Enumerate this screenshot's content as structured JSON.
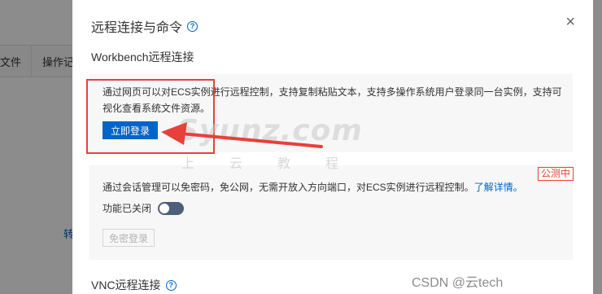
{
  "background": {
    "columns": [
      "文件",
      "操作记"
    ],
    "link_text": "转"
  },
  "dialog": {
    "title": "远程连接与命令",
    "close_glyph": "×",
    "workbench": {
      "label": "Workbench远程连接",
      "description": "通过网页可以对ECS实例进行远程控制，支持复制粘贴文本，支持多操作系统用户登录同一台实例，支持可视化查看系统文件资源。",
      "login_button": "立即登录"
    },
    "session": {
      "badge": "公测中",
      "description": "通过会话管理可以免密码，免公网，无需开放入方向端口，对ECS实例进行远程控制。",
      "link_text": "了解详情。",
      "toggle_label": "功能已关闭",
      "toggle_on": false,
      "passwordless_button": "免密登录"
    },
    "vnc": {
      "label": "VNC远程连接"
    }
  },
  "watermark": {
    "main": "Syunz.com",
    "sub": "上云教程",
    "csdn": "CSDN @云tech"
  },
  "colors": {
    "primary": "#0064c8",
    "highlight": "#e8403a",
    "card_bg": "#f7f7f7"
  }
}
